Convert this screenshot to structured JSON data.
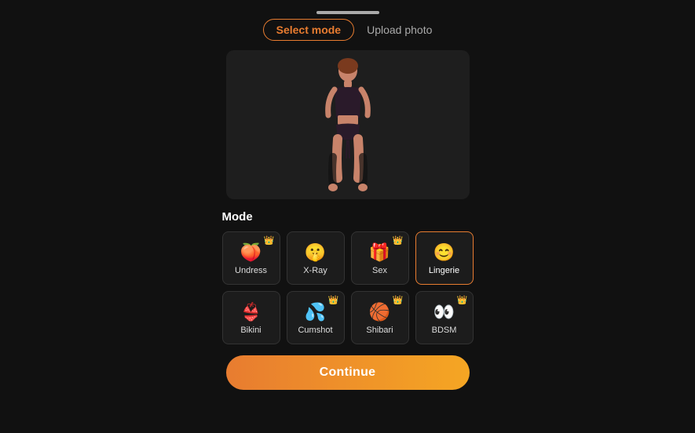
{
  "progress": {
    "bar_visible": true
  },
  "tabs": {
    "select_mode_label": "Select mode",
    "upload_photo_label": "Upload photo"
  },
  "mode_section": {
    "label": "Mode",
    "cards": [
      {
        "id": "undress",
        "emoji": "🍑",
        "label": "Undress",
        "crown": true,
        "active": false
      },
      {
        "id": "xray",
        "emoji": "🤫",
        "label": "X-Ray",
        "crown": false,
        "active": false
      },
      {
        "id": "sex",
        "emoji": "🎁",
        "label": "Sex",
        "crown": true,
        "active": false
      },
      {
        "id": "lingerie",
        "emoji": "😊",
        "label": "Lingerie",
        "crown": false,
        "active": true
      },
      {
        "id": "bikini",
        "emoji": "👙",
        "label": "Bikini",
        "crown": false,
        "active": false
      },
      {
        "id": "cumshot",
        "emoji": "💦",
        "label": "Cumshot",
        "crown": true,
        "active": false
      },
      {
        "id": "shibari",
        "emoji": "🏀",
        "label": "Shibari",
        "crown": true,
        "active": false
      },
      {
        "id": "bdsm",
        "emoji": "👀",
        "label": "BDSM",
        "crown": true,
        "active": false
      }
    ]
  },
  "continue_button": {
    "label": "Continue"
  }
}
